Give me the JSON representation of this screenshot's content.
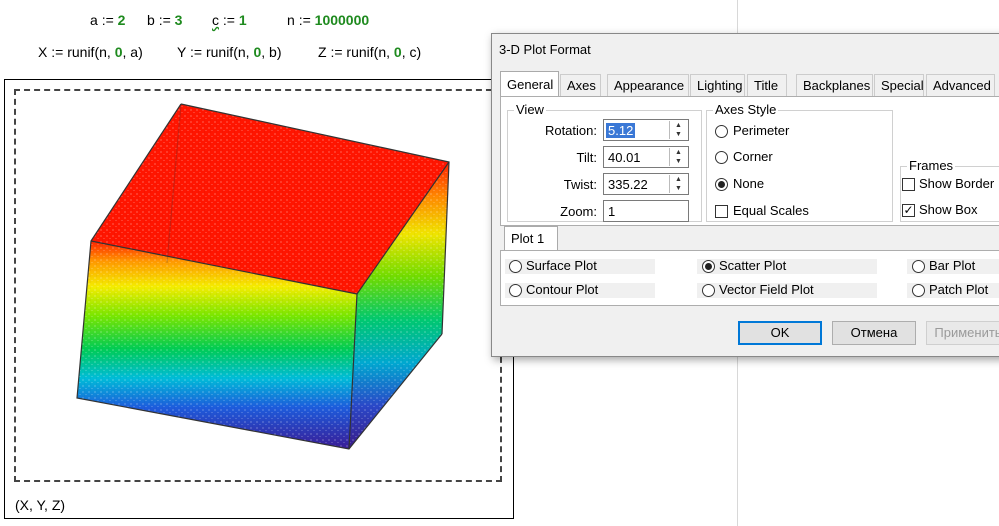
{
  "worksheet": {
    "defs": [
      {
        "name": "a",
        "op": ":=",
        "value": "2"
      },
      {
        "name": "b",
        "op": ":=",
        "value": "3"
      },
      {
        "name": "c",
        "op": ":=",
        "value": "1"
      },
      {
        "name": "n",
        "op": ":=",
        "value": "1000000"
      }
    ],
    "runif": [
      {
        "lhs": "X",
        "op": ":=",
        "fn": "runif",
        "args": [
          "n",
          "0",
          "a"
        ]
      },
      {
        "lhs": "Y",
        "op": ":=",
        "fn": "runif",
        "args": [
          "n",
          "0",
          "b"
        ]
      },
      {
        "lhs": "Z",
        "op": ":=",
        "fn": "runif",
        "args": [
          "n",
          "0",
          "c"
        ]
      }
    ],
    "plot_label": "(X, Y, Z)",
    "colors": {
      "number": "#1e8a1e",
      "top": "#ff1a00",
      "bottom": "#3b1fa0"
    }
  },
  "dialog": {
    "title": "3-D Plot Format",
    "tabs": [
      "General",
      "Axes",
      "Appearance",
      "Lighting",
      "Title",
      "Backplanes",
      "Special",
      "Advanced"
    ],
    "active_tab": "General",
    "view": {
      "title": "View",
      "rotation_label": "Rotation:",
      "rotation_value": "5.12",
      "tilt_label": "Tilt:",
      "tilt_value": "40.01",
      "twist_label": "Twist:",
      "twist_value": "335.22",
      "zoom_label": "Zoom:",
      "zoom_value": "1"
    },
    "axes_style": {
      "title": "Axes Style",
      "options": [
        "Perimeter",
        "Corner",
        "None"
      ],
      "selected": "None",
      "equal_scales_label": "Equal Scales",
      "equal_scales_checked": false
    },
    "frames": {
      "title": "Frames",
      "show_border_label": "Show Border",
      "show_border_checked": false,
      "show_box_label": "Show Box",
      "show_box_checked": true
    },
    "plot_tab": "Plot 1",
    "plot_types": [
      "Surface Plot",
      "Scatter Plot",
      "Bar Plot",
      "Contour Plot",
      "Vector Field Plot",
      "Patch Plot"
    ],
    "selected_plot_type": "Scatter Plot",
    "buttons": {
      "ok": "OK",
      "cancel": "Отмена",
      "apply": "Применить"
    }
  }
}
